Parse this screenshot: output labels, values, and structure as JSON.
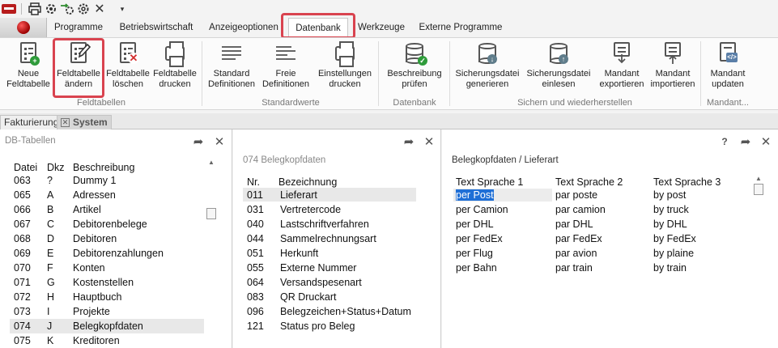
{
  "qat": {
    "icons": [
      "printer-icon",
      "gear-cycle-icon",
      "arrow-gear-icon",
      "settings-icon",
      "close-icon",
      "dropdown-icon"
    ]
  },
  "tabs": [
    "Programme",
    "Betriebswirtschaft",
    "Anzeigeoptionen",
    "Datenbank",
    "Werkzeuge",
    "Externe Programme"
  ],
  "ribbon": {
    "buttons": {
      "neue": "Neue\nFeldtabelle",
      "aendern": "Feldtabelle\nändern",
      "loeschen": "Feldtabelle\nlöschen",
      "drucken": "Feldtabelle\ndrucken",
      "standard": "Standard\nDefinitionen",
      "freie": "Freie\nDefinitionen",
      "einstellungen": "Einstellungen\ndrucken",
      "beschreibung": "Beschreibung\nprüfen",
      "sicherung_gen": "Sicherungsdatei\ngenerieren",
      "sicherung_ein": "Sicherungsdatei\neinlesen",
      "mandant_exp": "Mandant\nexportieren",
      "mandant_imp": "Mandant\nimportieren",
      "mandant_upd": "Mandant\nupdaten"
    },
    "groups": {
      "feldtabellen": "Feldtabellen",
      "standardwerte": "Standardwerte",
      "datenbank": "Datenbank",
      "sichern": "Sichern und wiederherstellen",
      "mandant": "Mandant..."
    }
  },
  "doc_tabs": [
    "Fakturierung",
    "System"
  ],
  "panel1": {
    "title": "DB-Tabellen",
    "headers": [
      "Datei",
      "Dkz",
      "Beschreibung"
    ],
    "rows": [
      [
        "063",
        "?",
        "Dummy 1"
      ],
      [
        "065",
        "A",
        "Adressen"
      ],
      [
        "066",
        "B",
        "Artikel"
      ],
      [
        "067",
        "C",
        "Debitorenbelege"
      ],
      [
        "068",
        "D",
        "Debitoren"
      ],
      [
        "069",
        "E",
        "Debitorenzahlungen"
      ],
      [
        "070",
        "F",
        "Konten"
      ],
      [
        "071",
        "G",
        "Kostenstellen"
      ],
      [
        "072",
        "H",
        "Hauptbuch"
      ],
      [
        "073",
        "I",
        "Projekte"
      ],
      [
        "074",
        "J",
        "Belegkopfdaten"
      ],
      [
        "075",
        "K",
        "Kreditoren"
      ]
    ]
  },
  "panel2": {
    "title": "074 Belegkopfdaten",
    "headers": [
      "Nr.",
      "Bezeichnung"
    ],
    "rows": [
      [
        "011",
        "Lieferart"
      ],
      [
        "031",
        "Vertretercode"
      ],
      [
        "040",
        "Lastschriftverfahren"
      ],
      [
        "044",
        "Sammelrechnungsart"
      ],
      [
        "051",
        "Herkunft"
      ],
      [
        "055",
        "Externe Nummer"
      ],
      [
        "064",
        "Versandspesenart"
      ],
      [
        "083",
        "QR Druckart"
      ],
      [
        "096",
        "Belegzeichen+Status+Datum"
      ],
      [
        "121",
        "Status pro Beleg"
      ]
    ]
  },
  "panel3": {
    "title": "Belegkopfdaten / Lieferart",
    "help": "?",
    "headers": [
      "Text Sprache 1",
      "Text Sprache 2",
      "Text Sprache 3"
    ],
    "rows": [
      [
        "per Post",
        "par poste",
        "by post"
      ],
      [
        "per Camion",
        "par camion",
        "by truck"
      ],
      [
        "per DHL",
        "par DHL",
        "by DHL"
      ],
      [
        "per FedEx",
        "par FedEx",
        "by FedEx"
      ],
      [
        "per Flug",
        "par avion",
        "by plaine"
      ],
      [
        "per Bahn",
        "par train",
        "by train"
      ]
    ]
  },
  "colors": {
    "highlight": "#d9434f",
    "selection": "#1f6fd6"
  }
}
